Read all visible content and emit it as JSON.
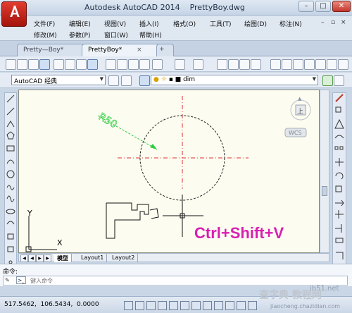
{
  "title_bar": {
    "title": "Autodesk AutoCAD 2014    PrettyBoy.dwg",
    "app_button_label": "A",
    "window_controls": [
      "minimize-icon",
      "maximize-icon",
      "close-icon"
    ]
  },
  "menu": {
    "row1": [
      "文件(F)",
      "编辑(E)",
      "视图(V)",
      "插入(I)",
      "格式(O)",
      "工具(T)",
      "绘图(D)",
      "标注(N)"
    ],
    "row2": [
      "修改(M)",
      "参数(P)",
      "窗口(W)",
      "帮助(H)"
    ]
  },
  "tabs": [
    {
      "label": "Pretty—Boy*",
      "active": false
    },
    {
      "label": "PrettyBoy*",
      "active": true
    }
  ],
  "toolbar": {
    "workspace": "AutoCAD 经典",
    "layer": "dim",
    "icons": [
      "new-icon",
      "open-icon",
      "save-icon",
      "plot-icon",
      "preview-icon",
      "publish-icon",
      "cut-icon",
      "copy-icon",
      "paste-icon",
      "matchprop-icon",
      "undo-icon",
      "redo-icon",
      "pan-icon",
      "zoom-icon",
      "properties-icon"
    ]
  },
  "canvas": {
    "dimension_text": "R50",
    "ucs_x": "X",
    "ucs_y": "Y",
    "viewcube_face": "上",
    "wcs_label": "WCS",
    "shortcut_text": "Ctrl+Shift+V",
    "layout_tabs": [
      "模型",
      "Layout1",
      "Layout2"
    ]
  },
  "command": {
    "prompt_label": "命令:",
    "input_placeholder": "键入命令"
  },
  "status": {
    "coords": "517.5462,  106.5434,  0.0000"
  },
  "watermarks": {
    "cn": "查字典 教程网",
    "site": "jb51.net",
    "url": "jiaocheng.chazidian.com"
  },
  "colors": {
    "shortcut": "#d81fb0",
    "dimension": "#2ecc40",
    "centerline": "#e03030"
  }
}
